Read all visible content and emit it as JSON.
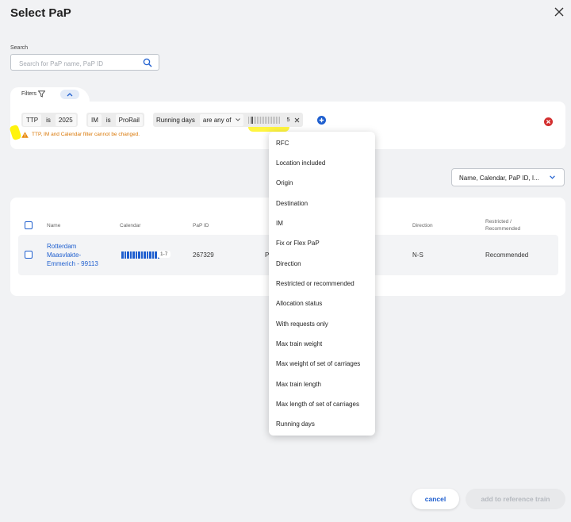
{
  "dialog": {
    "title": "Select PaP"
  },
  "search": {
    "label": "Search",
    "placeholder": "Search for PaP name, PaP ID"
  },
  "filters": {
    "label": "Filters",
    "chips": [
      {
        "field": "TTP",
        "op": "is",
        "value": "2025"
      },
      {
        "field": "IM",
        "op": "is",
        "value": "ProRail"
      }
    ],
    "running_days": {
      "field": "Running days",
      "op": "are any of",
      "count": "5"
    },
    "warning": "TTP, IM and Calendar filter cannot be changed."
  },
  "sort": {
    "selected": "Name, Calendar, PaP ID, I..."
  },
  "table": {
    "columns": [
      "Name",
      "Calendar",
      "PaP ID",
      "Direction",
      "Restricted /",
      "Recommended"
    ],
    "rows": [
      {
        "name_lines": [
          "Rotterdam",
          "Maasvlakte-",
          "Emmerich - 99113"
        ],
        "calendar_badge": "1-7",
        "pap_id": "267329",
        "partial": "P",
        "direction": "N-S",
        "restricted": "Recommended"
      }
    ]
  },
  "dropdown": {
    "items": [
      "RFC",
      "Location included",
      "Origin",
      "Destination",
      "IM",
      "Fix or Flex PaP",
      "Direction",
      "Restricted or recommended",
      "Allocation status",
      "With requests only",
      "Max train weight",
      "Max weight of set of carriages",
      "Max train length",
      "Max length of set of carriages",
      "Running days"
    ]
  },
  "footer": {
    "cancel": "cancel",
    "add": "add to reference train"
  },
  "colors": {
    "accent": "#1f5fcf",
    "warning": "#d97706",
    "error": "#d32f2f",
    "highlight": "#fff200"
  }
}
